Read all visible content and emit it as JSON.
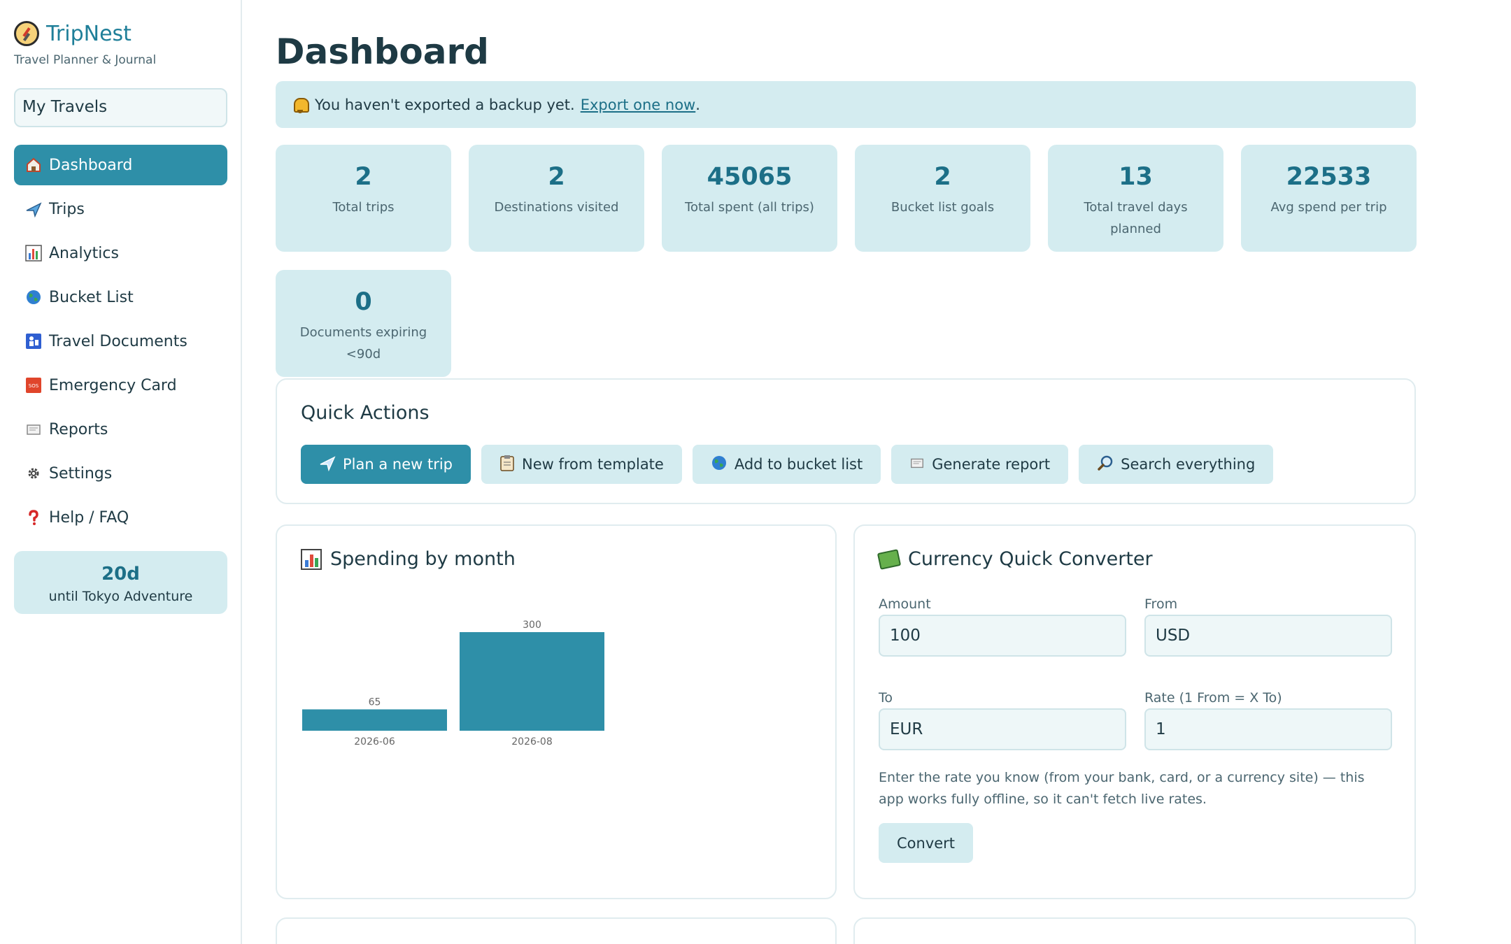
{
  "brand": {
    "name": "TripNest",
    "subtitle": "Travel Planner & Journal",
    "icon": "compass-icon"
  },
  "workspace": {
    "label": "My Travels"
  },
  "nav": [
    {
      "label": "Dashboard",
      "icon": "house-icon",
      "active": true
    },
    {
      "label": "Trips",
      "icon": "airplane-icon"
    },
    {
      "label": "Analytics",
      "icon": "bar-chart-icon"
    },
    {
      "label": "Bucket List",
      "icon": "globe-icon"
    },
    {
      "label": "Travel Documents",
      "icon": "passport-control-icon"
    },
    {
      "label": "Emergency Card",
      "icon": "sos-icon"
    },
    {
      "label": "Reports",
      "icon": "page-icon"
    },
    {
      "label": "Settings",
      "icon": "gear-icon"
    },
    {
      "label": "Help / FAQ",
      "icon": "question-icon"
    }
  ],
  "countdown": {
    "days": "20d",
    "label": "until Tokyo Adventure"
  },
  "page": {
    "title": "Dashboard"
  },
  "banner": {
    "text": "You haven't exported a backup yet.",
    "link": "Export one now",
    "trailing": "."
  },
  "stats": [
    {
      "value": "2",
      "label": "Total trips"
    },
    {
      "value": "2",
      "label": "Destinations visited"
    },
    {
      "value": "45065",
      "label": "Total spent (all trips)"
    },
    {
      "value": "2",
      "label": "Bucket list goals"
    },
    {
      "value": "13",
      "label": "Total travel days planned"
    },
    {
      "value": "22533",
      "label": "Avg spend per trip"
    },
    {
      "value": "0",
      "label": "Documents expiring <90d"
    }
  ],
  "quick_actions": {
    "title": "Quick Actions",
    "buttons": [
      {
        "label": "Plan a new trip",
        "icon": "airplane-icon"
      },
      {
        "label": "New from template",
        "icon": "clipboard-icon"
      },
      {
        "label": "Add to bucket list",
        "icon": "globe-icon"
      },
      {
        "label": "Generate report",
        "icon": "page-icon"
      },
      {
        "label": "Search everything",
        "icon": "magnifier-icon"
      }
    ]
  },
  "spending": {
    "title": "Spending by month",
    "icon": "bar-chart-icon"
  },
  "chart_data": {
    "type": "bar",
    "categories": [
      "2026-06",
      "2026-08"
    ],
    "values": [
      65,
      300
    ],
    "title": "Spending by month",
    "xlabel": "",
    "ylabel": "",
    "ylim": [
      0,
      300
    ],
    "color": "#2e8fa8",
    "grid": false
  },
  "converter": {
    "title": "Currency Quick Converter",
    "icon": "money-icon",
    "amount_label": "Amount",
    "amount_value": "100",
    "from_label": "From",
    "from_value": "USD",
    "to_label": "To",
    "to_value": "EUR",
    "rate_label": "Rate (1 From = X To)",
    "rate_value": "1",
    "note": "Enter the rate you know (from your bank, card, or a currency site) — this app works fully offline, so it can't fetch live rates.",
    "button": "Convert"
  },
  "colors": {
    "accent": "#2e8fa8",
    "tint": "#d4ecf0",
    "heading": "#1c6f87"
  }
}
